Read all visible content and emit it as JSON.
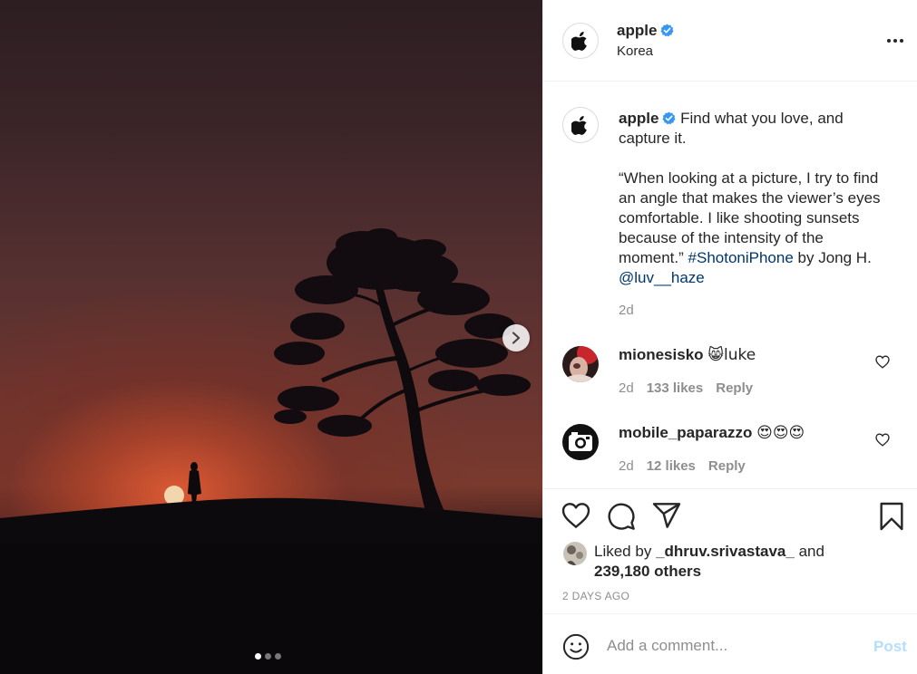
{
  "post": {
    "author": "apple",
    "verified": true,
    "location": "Korea"
  },
  "caption": {
    "author": "apple",
    "line1": "Find what you love, and capture it.",
    "quote": "“When looking at a picture, I try to find an angle that makes the viewer’s eyes comfortable. I like shooting sunsets because of the intensity of the moment.”",
    "hashtag": "#ShotoniPhone",
    "byline": "by Jong H.",
    "mention": "@luv__haze",
    "time": "2d"
  },
  "comments": [
    {
      "user": "mionesisko",
      "text": "😸luke",
      "time": "2d",
      "likes": "133 likes",
      "reply": "Reply"
    },
    {
      "user": "mobile_paparazzo",
      "text": "😍😍😍",
      "time": "2d",
      "likes": "12 likes",
      "reply": "Reply"
    }
  ],
  "likes": {
    "prefix": "Liked by",
    "user": "_dhruv.srivastava_",
    "conj": "and",
    "others": "239,180 others"
  },
  "date": "2 DAYS AGO",
  "add_comment": {
    "placeholder": "Add a comment...",
    "post_label": "Post"
  },
  "carousel": {
    "count": 3,
    "active": 1
  },
  "icons": {
    "verified": "verified-badge-icon",
    "more": "more-options-icon",
    "like": "heart-icon",
    "comment": "comment-bubble-icon",
    "share": "paper-plane-icon",
    "save": "bookmark-icon",
    "emoji": "smiley-icon",
    "next": "chevron-right-icon"
  },
  "colors": {
    "verified": "#3897f0",
    "link": "#00376b",
    "post_disabled": "#b2dffc",
    "muted": "#8e8e8e"
  }
}
